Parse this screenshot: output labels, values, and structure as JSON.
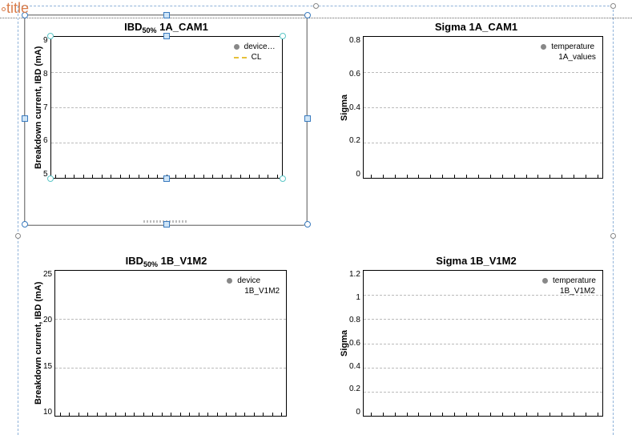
{
  "editor": {
    "title_placeholder_label": "title"
  },
  "chart_data": [
    {
      "id": "ibd-1a",
      "type": "line",
      "title_prefix": "IBD",
      "title_sub": "50%",
      "title_suffix": " 1A_CAM1",
      "ylabel": "Breakdown current, IBD (mA)",
      "yticks": [
        "9",
        "8",
        "7",
        "6",
        "5"
      ],
      "ylim": [
        5,
        9
      ],
      "x": [],
      "series": [
        {
          "name": "device…",
          "marker": "dot",
          "values": []
        },
        {
          "name": "CL",
          "marker": "dash",
          "values": []
        }
      ]
    },
    {
      "id": "sigma-1a",
      "type": "line",
      "title": "Sigma 1A_CAM1",
      "ylabel": "Sigma",
      "yticks": [
        "0.8",
        "0.6",
        "0.4",
        "0.2",
        "0"
      ],
      "ylim": [
        0,
        0.8
      ],
      "x": [],
      "series": [
        {
          "name": "temperature",
          "marker": "dot",
          "values": []
        }
      ],
      "legend_sub": "1A_values"
    },
    {
      "id": "ibd-1b",
      "type": "line",
      "title_prefix": "IBD",
      "title_sub": "50%",
      "title_suffix": " 1B_V1M2",
      "ylabel": "Breakdown current, IBD (mA)",
      "yticks": [
        "25",
        "20",
        "15",
        "10"
      ],
      "ylim": [
        10,
        25
      ],
      "x": [],
      "series": [
        {
          "name": "device",
          "marker": "dot",
          "values": []
        }
      ],
      "legend_sub": "1B_V1M2"
    },
    {
      "id": "sigma-1b",
      "type": "line",
      "title": "Sigma 1B_V1M2",
      "ylabel": "Sigma",
      "yticks": [
        "1.2",
        "1",
        "0.8",
        "0.6",
        "0.4",
        "0.2",
        "0"
      ],
      "ylim": [
        0,
        1.2
      ],
      "x": [],
      "series": [
        {
          "name": "temperature",
          "marker": "dot",
          "values": []
        }
      ],
      "legend_sub": "1B_V1M2"
    }
  ]
}
